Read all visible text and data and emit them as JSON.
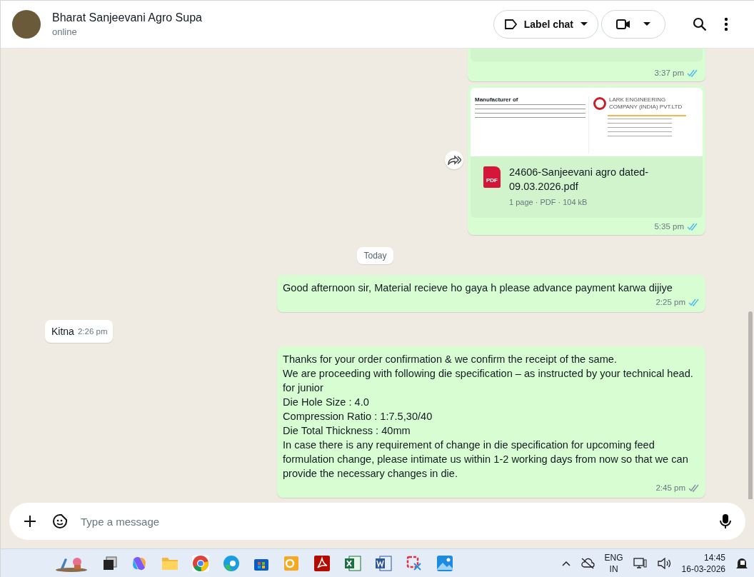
{
  "chat_header": {
    "name": "Bharat Sanjeevani Agro Supa",
    "status": "online",
    "label_button": "Label chat"
  },
  "messages": [
    {
      "kind": "cut",
      "outgoing": true,
      "time": "3:37 pm",
      "read": true
    },
    {
      "kind": "document",
      "outgoing": true,
      "preview": {
        "heading": "Manufacturer of",
        "company": "LARK ENGINEERING COMPANY (INDIA) PVT.LTD"
      },
      "file_name": "24606-Sanjeevani agro dated-09.03.2026.pdf",
      "file_type": "PDF",
      "meta": "1 page · PDF · 104 kB",
      "time": "5:35 pm",
      "read": true
    },
    {
      "kind": "date",
      "text": "Today"
    },
    {
      "kind": "text",
      "outgoing": true,
      "lines": [
        "Good afternoon sir, Material recieve ho gaya h please advance payment karwa dijiye"
      ],
      "time": "2:25 pm",
      "read": true
    },
    {
      "kind": "text",
      "outgoing": false,
      "lines": [
        "Kitna"
      ],
      "time": "2:26 pm"
    },
    {
      "kind": "text",
      "outgoing": true,
      "lines": [
        "Thanks for your order confirmation & we confirm the receipt of the same.",
        "We are proceeding with following die specification –  as instructed by your technical head.",
        "for junior",
        "Die Hole Size : 4.0",
        "Compression Ratio : 1:7.5,30/40",
        "Die Total Thickness : 40mm",
        "In case there is any requirement of change in die specification for upcoming feed formulation change, please intimate us within 1-2 working days from now so that we can provide the necessary changes in die."
      ],
      "time": "2:45 pm",
      "read": false
    }
  ],
  "composer": {
    "placeholder": "Type a message"
  },
  "taskbar": {
    "language": "ENG",
    "region": "IN",
    "time": "14:45",
    "date": "16-03-2026"
  }
}
